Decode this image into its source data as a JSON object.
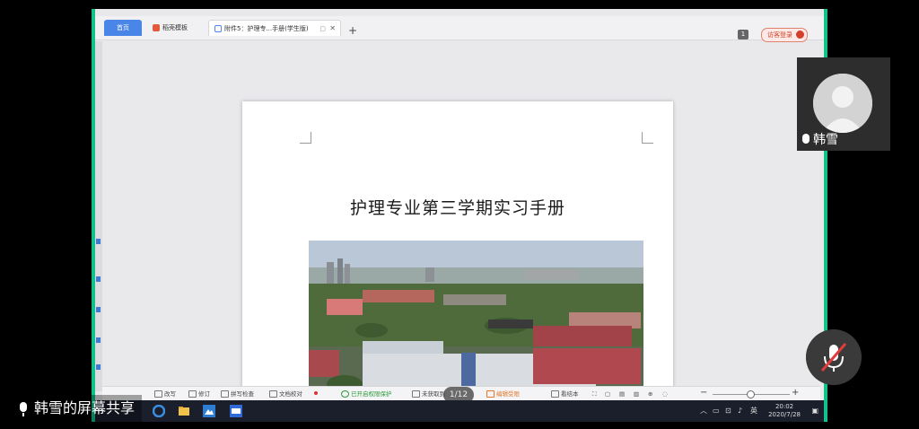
{
  "tabs": {
    "home_label": "首页",
    "template_label": "稻壳模板",
    "doc_label": "附件5：护理专...手册(学生版)",
    "new_tab_label": "+"
  },
  "topright": {
    "badge": "1",
    "login_label": "访客登录"
  },
  "document": {
    "title": "护理专业第三学期实习手册"
  },
  "statusbar": {
    "items": [
      "改写",
      "修订",
      "拼写检查",
      "文档校对",
      "已开启权限保护",
      "未获取到",
      "编辑受限",
      "看结本"
    ]
  },
  "page_indicator": "1/12",
  "taskbar": {
    "lang": "英",
    "time": "20:02",
    "date": "2020/7/28"
  },
  "overlay": {
    "share_label": "韩雪的屏幕共享",
    "participant_name": "韩雪"
  },
  "colors": {
    "accent_green": "#12c28a",
    "tab_blue": "#4a86e8",
    "login_red": "#d2402a"
  }
}
